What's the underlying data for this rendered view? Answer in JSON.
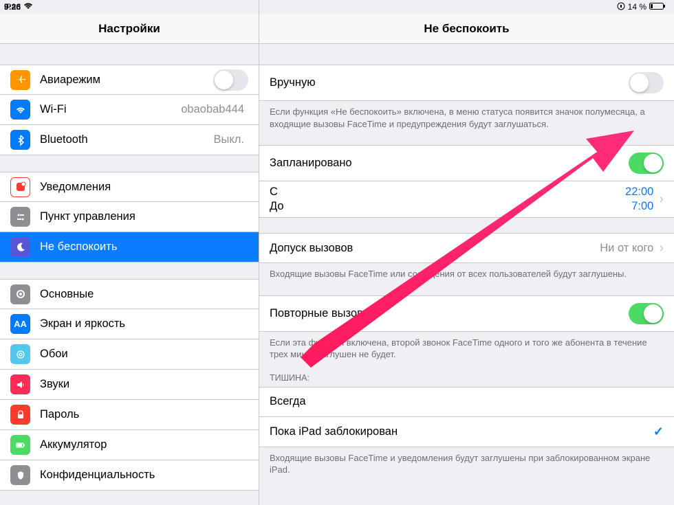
{
  "status": {
    "device": "iPad",
    "time": "9:26",
    "battery": "14 %"
  },
  "sidebar": {
    "title": "Настройки",
    "g1": [
      {
        "key": "airplane",
        "label": "Авиарежим",
        "bg": "#ff9500",
        "toggle": false
      },
      {
        "key": "wifi",
        "label": "Wi-Fi",
        "value": "obaobab444",
        "bg": "#007aff"
      },
      {
        "key": "bluetooth",
        "label": "Bluetooth",
        "value": "Выкл.",
        "bg": "#007aff"
      }
    ],
    "g2": [
      {
        "key": "notifications",
        "label": "Уведомления",
        "bg": "#ff3b30"
      },
      {
        "key": "control",
        "label": "Пункт управления",
        "bg": "#8e8e93"
      },
      {
        "key": "dnd",
        "label": "Не беспокоить",
        "bg": "#5856d6",
        "selected": true
      }
    ],
    "g3": [
      {
        "key": "general",
        "label": "Основные",
        "bg": "#8e8e93"
      },
      {
        "key": "display",
        "label": "Экран и яркость",
        "bg": "#007aff"
      },
      {
        "key": "wallpaper",
        "label": "Обои",
        "bg": "#54c7ec"
      },
      {
        "key": "sounds",
        "label": "Звуки",
        "bg": "#ff2d55"
      },
      {
        "key": "passcode",
        "label": "Пароль",
        "bg": "#ff3b30"
      },
      {
        "key": "battery",
        "label": "Аккумулятор",
        "bg": "#4cd964"
      },
      {
        "key": "privacy",
        "label": "Конфиденциальность",
        "bg": "#8e8e93"
      }
    ]
  },
  "detail": {
    "title": "Не беспокоить",
    "manual": {
      "label": "Вручную",
      "on": false
    },
    "manual_footer": "Если функция «Не беспокоить» включена, в меню статуса появится значок полумесяца, а входящие вызовы FaceTime и предупреждения будут заглушаться.",
    "scheduled": {
      "label": "Запланировано",
      "on": true
    },
    "times": {
      "from_label": "С",
      "from": "22:00",
      "to_label": "До",
      "to": "7:00"
    },
    "allow": {
      "label": "Допуск вызовов",
      "value": "Ни от кого"
    },
    "allow_footer": "Входящие вызовы FaceTime или сообщения от всех пользователей будут заглушены.",
    "repeated": {
      "label": "Повторные вызовы",
      "on": true
    },
    "repeated_footer": "Если эта функция включена, второй звонок FaceTime одного и того же абонента в течение трех минут заглушен не будет.",
    "silence_header": "ТИШИНА:",
    "silence": [
      {
        "label": "Всегда",
        "checked": false
      },
      {
        "label": "Пока iPad заблокирован",
        "checked": true
      }
    ],
    "silence_footer": "Входящие вызовы FaceTime и уведомления будут заглушены при заблокированном экране iPad."
  }
}
